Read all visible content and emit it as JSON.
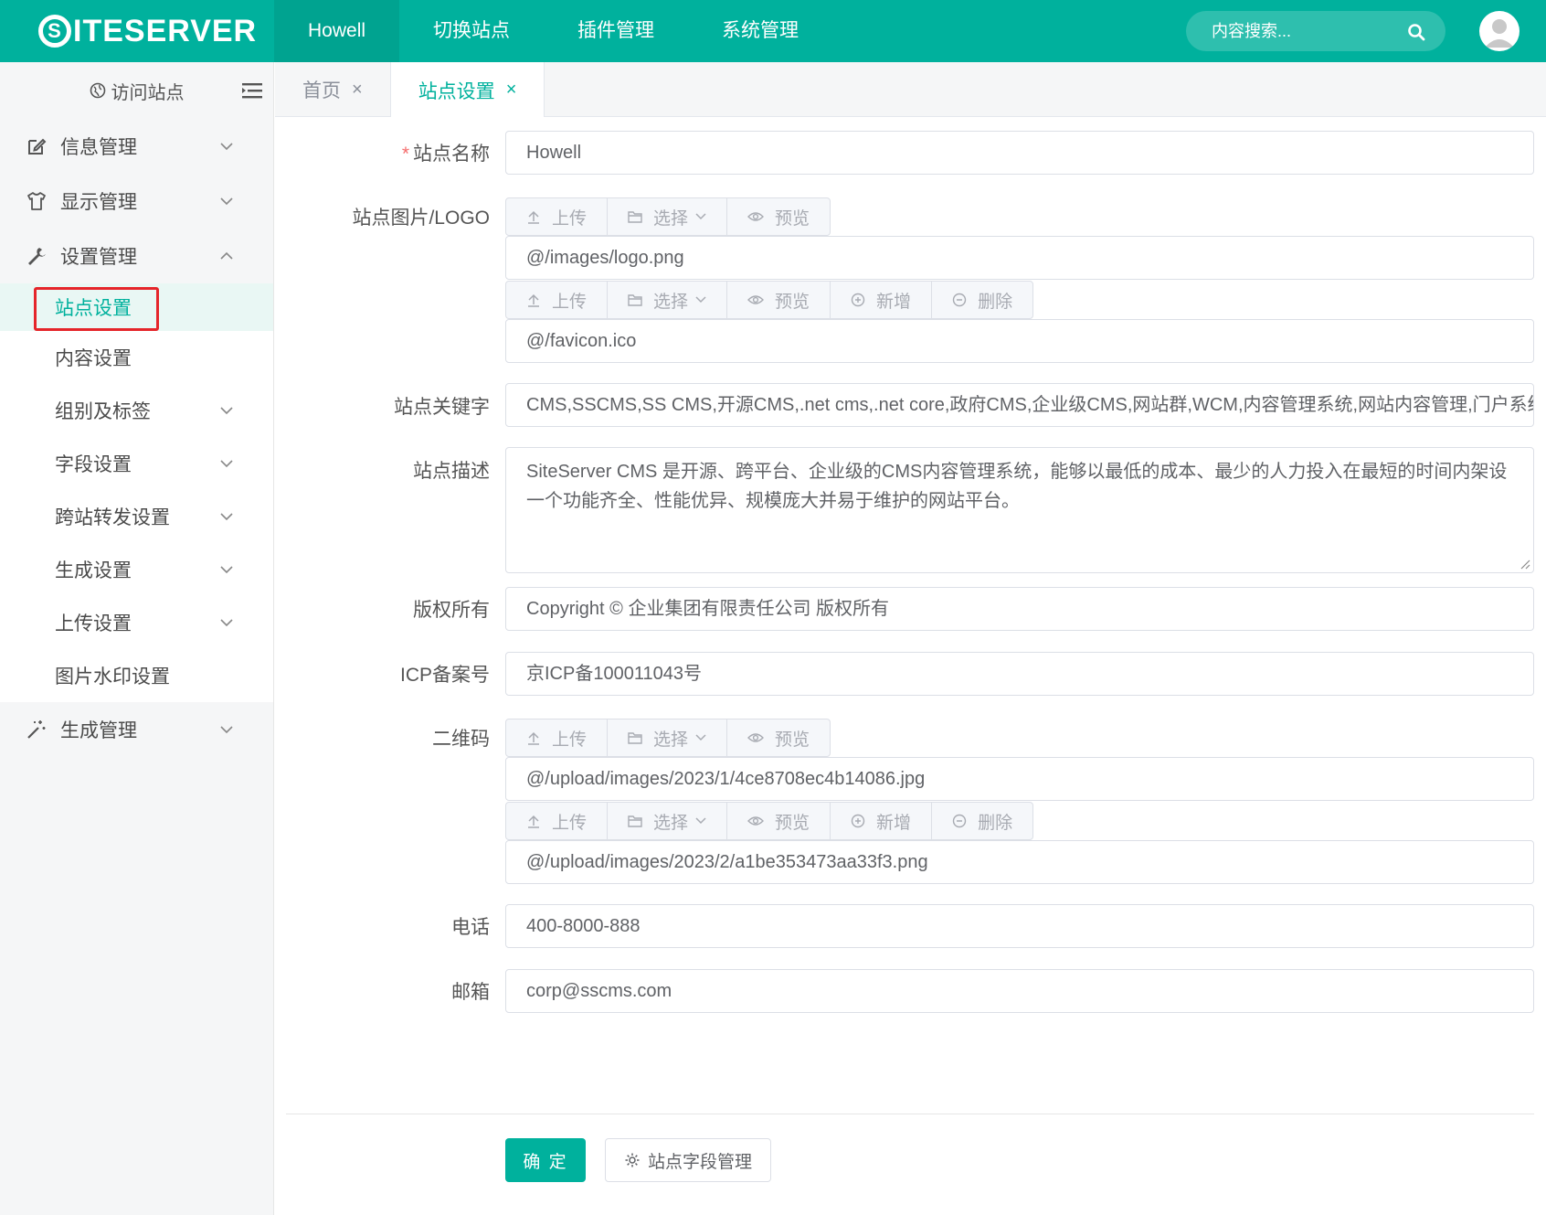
{
  "header": {
    "logo_rest": "ITESERVER",
    "logo_s": "S",
    "nav": [
      "Howell",
      "切换站点",
      "插件管理",
      "系统管理"
    ],
    "search_placeholder": "内容搜索..."
  },
  "sidebar": {
    "visit_site": "访问站点",
    "menu": {
      "info": "信息管理",
      "display": "显示管理",
      "settings": "设置管理",
      "generate": "生成管理"
    },
    "sub": [
      "站点设置",
      "内容设置",
      "组别及标签",
      "字段设置",
      "跨站转发设置",
      "生成设置",
      "上传设置",
      "图片水印设置"
    ]
  },
  "tabs": {
    "home": "首页",
    "site_settings": "站点设置",
    "close": "×"
  },
  "form": {
    "required_mark": "*",
    "site_name_label": "站点名称",
    "site_name": "Howell",
    "logo_label": "站点图片/LOGO",
    "logo_value": "@/images/logo.png",
    "favicon_value": "@/favicon.ico",
    "keywords_label": "站点关键字",
    "keywords": "CMS,SSCMS,SS CMS,开源CMS,.net cms,.net core,政府CMS,企业级CMS,网站群,WCM,内容管理系统,网站内容管理,门户系统",
    "desc_label": "站点描述",
    "desc": "SiteServer CMS 是开源、跨平台、企业级的CMS内容管理系统，能够以最低的成本、最少的人力投入在最短的时间内架设一个功能齐全、性能优异、规模庞大并易于维护的网站平台。",
    "copyright_label": "版权所有",
    "copyright": "Copyright © 企业集团有限责任公司  版权所有",
    "icp_label": "ICP备案号",
    "icp": "京ICP备100011043号",
    "qrcode_label": "二维码",
    "qrcode_1": "@/upload/images/2023/1/4ce8708ec4b14086.jpg",
    "qrcode_2": "@/upload/images/2023/2/a1be353473aa33f3.png",
    "phone_label": "电话",
    "phone": "400-8000-888",
    "email_label": "邮箱",
    "email": "corp@sscms.com",
    "btn_upload": "上传",
    "btn_select": "选择",
    "btn_preview": "预览",
    "btn_add": "新增",
    "btn_delete": "删除",
    "submit": "确 定",
    "field_manage": "站点字段管理"
  },
  "colors": {
    "brand": "#00b19d",
    "highlight_box": "#e5252a",
    "required": "#f56c6c"
  }
}
